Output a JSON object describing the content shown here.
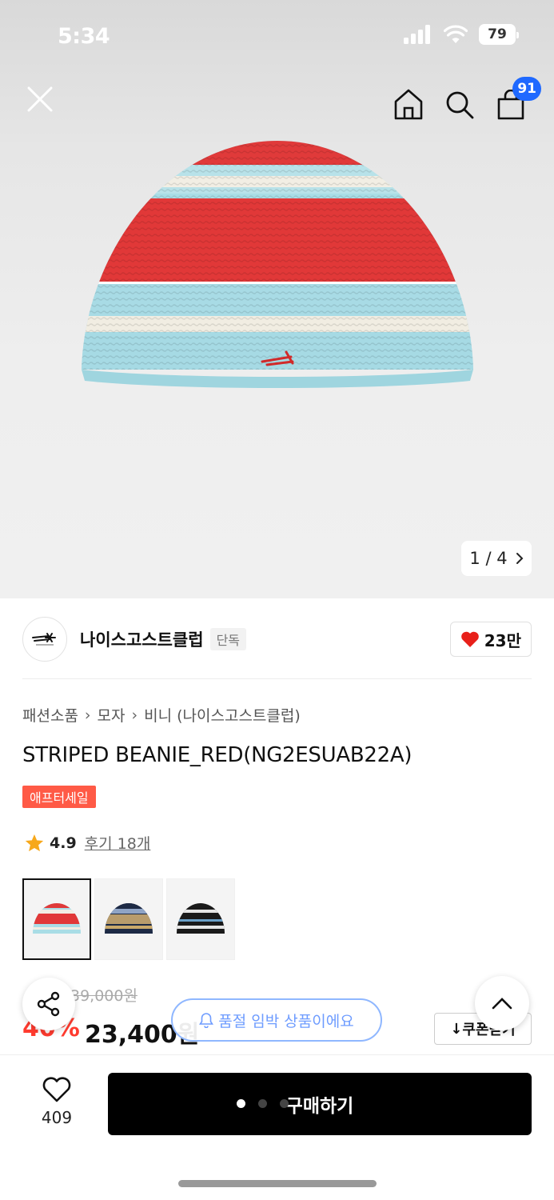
{
  "status_bar": {
    "time": "5:34",
    "battery": "79"
  },
  "header": {
    "cart_badge": "91"
  },
  "image": {
    "page_indicator": "1 / 4",
    "current_page": 1,
    "total_pages": 4
  },
  "brand": {
    "name": "나이스고스트클럽",
    "tag": "단독",
    "likes": "23만"
  },
  "breadcrumb": [
    "패션소품",
    "모자",
    "비니 (나이스고스트클럽)"
  ],
  "product": {
    "title": "STRIPED BEANIE_RED(NG2ESUAB22A)",
    "sale_badge": "애프터세일",
    "rating": "4.9",
    "review_link": "후기 18개"
  },
  "colors": [
    {
      "name": "red",
      "selected": true
    },
    {
      "name": "beige-navy",
      "selected": false
    },
    {
      "name": "black",
      "selected": false
    }
  ],
  "price": {
    "original": "39,000원",
    "discount": "40%",
    "final": "23,400원",
    "soldout_notice": "품절 임박 상품이에요",
    "coupon_label": "쿠폰받기"
  },
  "bottom_bar": {
    "wish_count": "409",
    "buy_label": "구매하기"
  },
  "colors_theme": {
    "accent_red": "#ff3b2f",
    "badge_blue": "#1f69ff",
    "sale_badge": "#ff5a46"
  }
}
